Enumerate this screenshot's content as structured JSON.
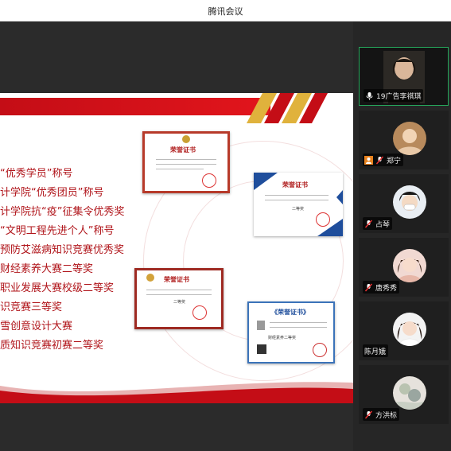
{
  "app": {
    "title": "腾讯会议"
  },
  "slide": {
    "awards": [
      "“优秀学员”称号",
      "计学院“优秀团员”称号",
      "计学院抗“疫”征集令优秀奖",
      "“文明工程先进个人”称号",
      "预防艾滋病知识竞赛优秀奖",
      "财经素养大赛二等奖",
      "职业发展大赛校级二等奖",
      "识竞赛三等奖",
      "雪创意设计大赛",
      "质知识竞赛初赛二等奖"
    ],
    "certificates": [
      {
        "title": "荣誉证书"
      },
      {
        "title": "荣誉证书",
        "line": "二等奖"
      },
      {
        "title": "荣誉证书",
        "line": "二等奖"
      },
      {
        "title": "《荣誉证书》",
        "line": "财经素养二等奖"
      }
    ]
  },
  "participants": [
    {
      "name": "19广告李祺琪",
      "badge": "mic",
      "active": true
    },
    {
      "name": "郑宁",
      "badge": "user-mic"
    },
    {
      "name": "占琴",
      "badge": "mic-muted"
    },
    {
      "name": "唐秀秀",
      "badge": "mic-muted"
    },
    {
      "name": "陈月娥",
      "badge": "none"
    },
    {
      "name": "方洪标",
      "badge": "mic-muted"
    }
  ],
  "colors": {
    "accent_red": "#c40d16",
    "active_border": "#26a65b",
    "sidebar_bg": "#262626"
  }
}
